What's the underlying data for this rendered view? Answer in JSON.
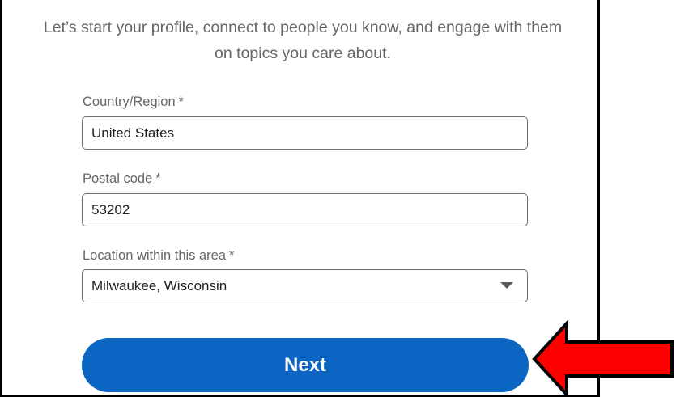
{
  "intro": {
    "line1": "Let’s start your profile, connect to people you know, and engage with them",
    "line2": "on topics you care about."
  },
  "fields": {
    "country": {
      "label": "Country/Region",
      "required_mark": "*",
      "value": "United States"
    },
    "postal": {
      "label": "Postal code",
      "required_mark": "*",
      "value": "53202"
    },
    "location": {
      "label": "Location within this area",
      "required_mark": "*",
      "value": "Milwaukee, Wisconsin",
      "icon": "chevron-down-icon"
    }
  },
  "next_button": {
    "label": "Next"
  },
  "colors": {
    "primary_blue": "#0a66c2",
    "annotation_arrow": "#ff0000",
    "text_muted": "#666666"
  }
}
